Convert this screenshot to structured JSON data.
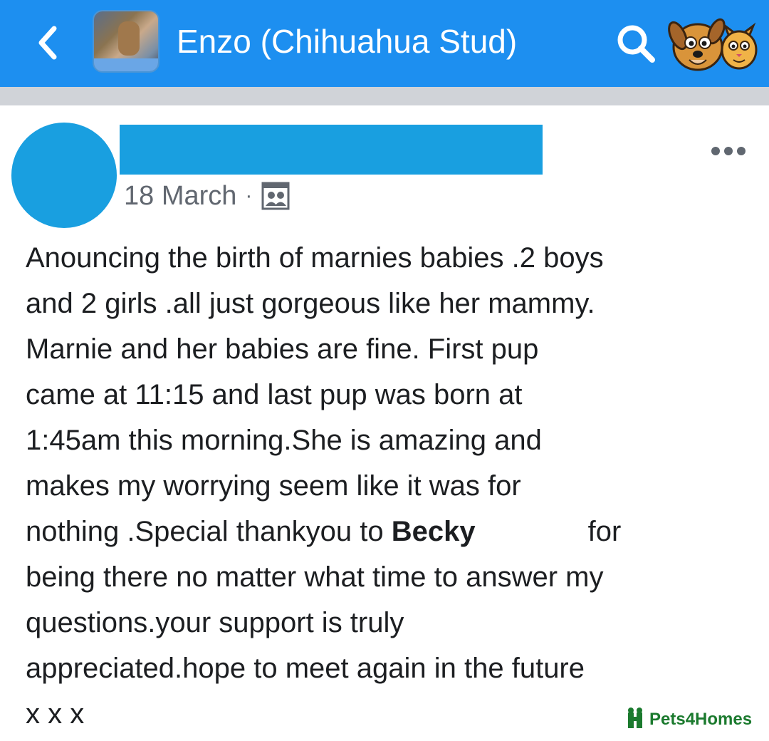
{
  "header": {
    "group_title": "Enzo (Chihuahua Stud)",
    "group_thumb_caption": "",
    "accent_color": "#1d8ff0",
    "icons": [
      "chevron-left-icon",
      "group-thumbnail",
      "search-icon",
      "pets-logo-icon"
    ]
  },
  "post": {
    "author_name": "",
    "date": "18 March",
    "separator": "·",
    "privacy_icon": "group-members-icon",
    "more_icon": "ellipsis-icon",
    "lines": {
      "l1": "Anouncing the birth of marnies babies .2 boys",
      "l2": "and 2 girls .all just gorgeous like her mammy.",
      "l3": "Marnie and her babies are fine. First pup",
      "l4": "came at 11:15 and last pup was born at",
      "l5": "1:45am this morning.She is amazing and",
      "l6": "makes my worrying seem like it was for",
      "l7a": "nothing .Special thankyou to ",
      "l7_mention": "Becky",
      "l7b": "for",
      "l8": "being there no matter what time to answer my",
      "l9": "questions.your support is truly",
      "l10": "appreciated.hope to meet again in the future",
      "l11": "x x x"
    }
  },
  "watermark": {
    "text": "Pets4Homes",
    "color": "#1b7a2e"
  }
}
